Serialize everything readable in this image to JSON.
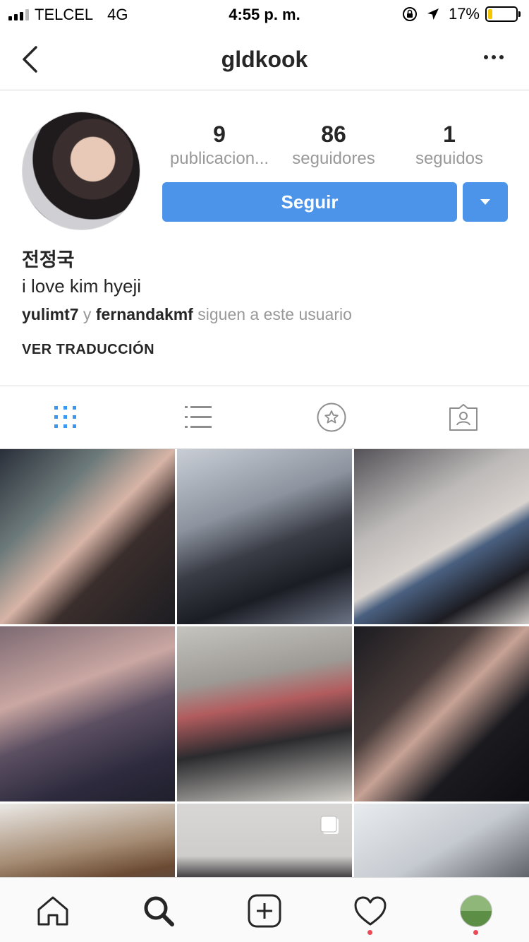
{
  "status_bar": {
    "carrier": "TELCEL",
    "network": "4G",
    "time": "4:55 p. m.",
    "battery": "17%",
    "battery_level": 0.17,
    "battery_color": "#f5c600"
  },
  "nav": {
    "title": "gldkook",
    "back_icon": "chevron-left-icon",
    "more_icon": "more-horizontal-icon"
  },
  "profile": {
    "stats": [
      {
        "num": "9",
        "label": "publicacion..."
      },
      {
        "num": "86",
        "label": "seguidores"
      },
      {
        "num": "1",
        "label": "seguidos"
      }
    ],
    "follow_label": "Seguir",
    "follow_color": "#4c93ea",
    "full_name": "전정국",
    "bio": "i love kim hyeji",
    "followed_by": {
      "user1": "yulimt7",
      "conj": "y",
      "user2": "fernandakmf",
      "suffix": "siguen a este usuario"
    },
    "translate": "VER TRADUCCIÓN"
  },
  "tabs": {
    "active_color": "#3897f0",
    "items": [
      "grid-icon",
      "list-icon",
      "star-icon",
      "tagged-icon"
    ]
  },
  "bottom_nav": {
    "items": [
      "home-icon",
      "search-icon",
      "add-icon",
      "heart-icon",
      "profile-avatar"
    ],
    "notification_color": "#ed4956"
  }
}
